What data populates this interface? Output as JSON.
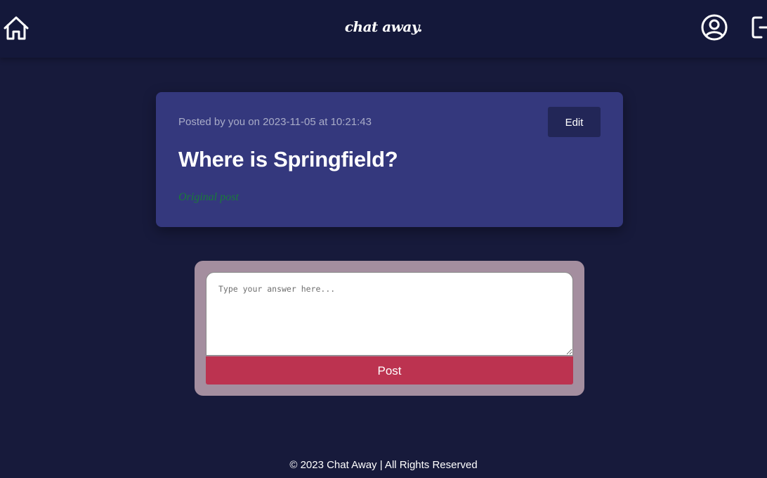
{
  "nav": {
    "brand": "chat away.",
    "home_icon": "home-icon",
    "profile_icon": "user-circle-icon",
    "logout_icon": "logout-icon"
  },
  "post": {
    "meta_prefix": "Posted by you on ",
    "date": "2023-11-05",
    "meta_mid": " at ",
    "time": "10:21:43",
    "edit_label": "Edit",
    "title": "Where is Springfield?",
    "tag": "Original post"
  },
  "answer": {
    "placeholder": "Type your answer here...",
    "value": "",
    "submit_label": "Post"
  },
  "footer": {
    "text": "© 2023 Chat Away | All Rights Reserved"
  },
  "colors": {
    "page_bg": "#171a3b",
    "navbar_bg": "#14183a",
    "card_bg": "#34387d",
    "edit_button_bg": "#222657",
    "answer_panel_bg": "#a48e9f",
    "post_button_bg": "#bc3350",
    "tag_green": "#1a7a3a"
  }
}
